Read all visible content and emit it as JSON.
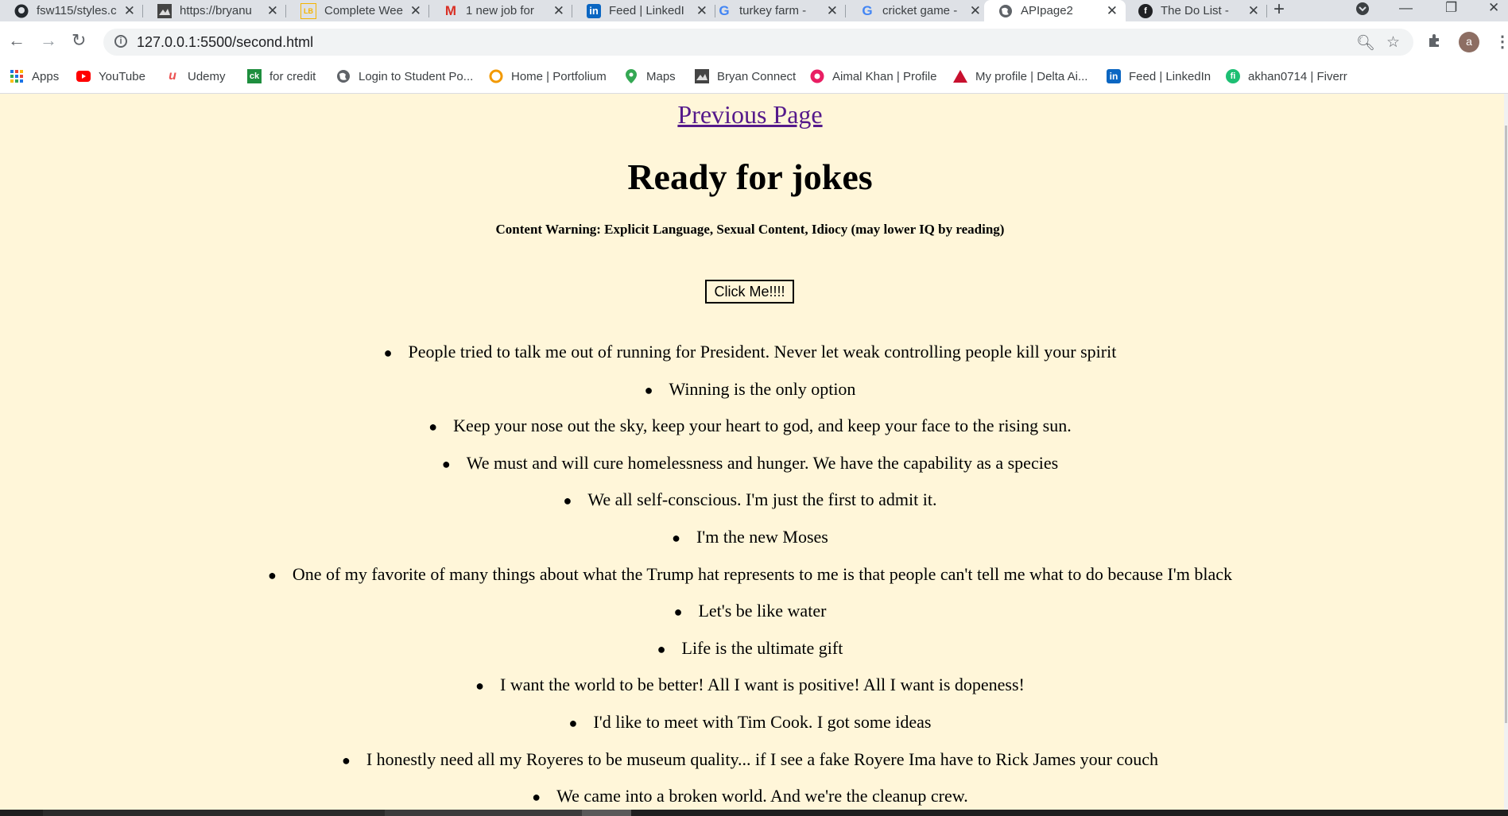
{
  "browser": {
    "tabs": [
      {
        "label": "fsw115/styles.c",
        "icon": "github-icon"
      },
      {
        "label": "https://bryanu",
        "icon": "bryan-icon"
      },
      {
        "label": "Complete Wee",
        "icon": "doc-icon"
      },
      {
        "label": "1 new job for",
        "icon": "gmail-icon"
      },
      {
        "label": "Feed | LinkedI",
        "icon": "linkedin-icon"
      },
      {
        "label": "turkey farm -",
        "icon": "google-icon"
      },
      {
        "label": "cricket game -",
        "icon": "google-icon"
      },
      {
        "label": "APIpage2",
        "icon": "globe-icon"
      },
      {
        "label": "The Do List -",
        "icon": "todo-icon"
      }
    ],
    "new_tab": "+",
    "url": "127.0.0.1:5500/second.html",
    "profile_initial": "a"
  },
  "bookmarks": [
    {
      "label": "Apps",
      "icon": "apps-grid-icon"
    },
    {
      "label": "YouTube",
      "icon": "youtube-icon"
    },
    {
      "label": "Udemy",
      "icon": "udemy-icon"
    },
    {
      "label": "for credit",
      "icon": "ck-icon"
    },
    {
      "label": "Login to Student Po...",
      "icon": "globe-icon"
    },
    {
      "label": "Home | Portfolium",
      "icon": "portfolium-icon"
    },
    {
      "label": "Maps",
      "icon": "maps-pin-icon"
    },
    {
      "label": "Bryan Connect",
      "icon": "bryan-icon"
    },
    {
      "label": "Aimal Khan | Profile",
      "icon": "profile-icon"
    },
    {
      "label": "My profile | Delta Ai...",
      "icon": "delta-icon"
    },
    {
      "label": "Feed | LinkedIn",
      "icon": "linkedin-icon"
    },
    {
      "label": "akhan0714 | Fiverr",
      "icon": "fiverr-icon"
    }
  ],
  "page": {
    "previous_link": "Previous Page",
    "heading": "Ready for jokes",
    "warning": "Content Warning: Explicit Language, Sexual Content, Idiocy (may lower IQ by reading)",
    "button_label": "Click Me!!!!",
    "jokes": [
      "People tried to talk me out of running for President. Never let weak controlling people kill your spirit",
      "Winning is the only option",
      "Keep your nose out the sky, keep your heart to god, and keep your face to the rising sun.",
      "We must and will cure homelessness and hunger. We have the capability as a species",
      "We all self-conscious. I'm just the first to admit it.",
      "I'm the new Moses",
      "One of my favorite of many things about what the Trump hat represents to me is that people can't tell me what to do because I'm black",
      "Let's be like water",
      "Life is the ultimate gift",
      "I want the world to be better! All I want is positive! All I want is dopeness!",
      "I'd like to meet with Tim Cook. I got some ideas",
      "I honestly need all my Royeres to be museum quality... if I see a fake Royere Ima have to Rick James your couch",
      "We came into a broken world. And we're the cleanup crew."
    ]
  },
  "colors": {
    "page_background": "#fff6d9",
    "link_visited": "#551a8b",
    "tab_strip": "#dee1e6"
  }
}
